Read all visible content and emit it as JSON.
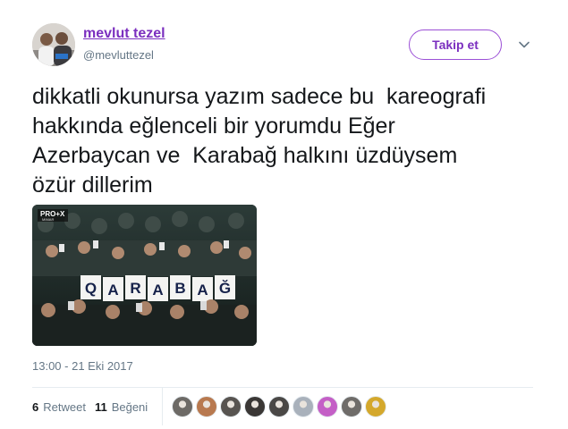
{
  "author": {
    "name": "mevlut tezel",
    "handle": "@mevluttezel"
  },
  "follow_button": {
    "label": "Takip et"
  },
  "menu_icon": "chevron-down-icon",
  "tweet": {
    "text": "dikkatli okunursa yazım sadece bu  kareografi\nhakkında eğlenceli bir yorumdu Eğer\nAzerbaycan ve  Karabağ halkını üzdüysem\nözür dillerim",
    "timestamp": "13:00 - 21 Eki 2017"
  },
  "media": {
    "banner_letters": [
      "Q",
      "A",
      "R",
      "A",
      "B",
      "A",
      "Ğ"
    ],
    "tv_logo": "PRO+X",
    "tv_logo_sub": "MIMAR"
  },
  "stats": {
    "retweet_count": "6",
    "retweet_label": "Retweet",
    "like_count": "11",
    "like_label": "Beğeni"
  },
  "likers": [
    {
      "name": "liker-avatar-1",
      "color": "#6d6a66"
    },
    {
      "name": "liker-avatar-2",
      "color": "#b8794f"
    },
    {
      "name": "liker-avatar-3",
      "color": "#585450"
    },
    {
      "name": "liker-avatar-4",
      "color": "#3a3735"
    },
    {
      "name": "liker-avatar-5",
      "color": "#4a4846"
    },
    {
      "name": "liker-avatar-6",
      "color": "#a9b1bb"
    },
    {
      "name": "liker-avatar-7",
      "color": "#c45fc6"
    },
    {
      "name": "liker-avatar-8",
      "color": "#6f6c69"
    },
    {
      "name": "liker-avatar-9",
      "color": "#d4a82c"
    }
  ],
  "colors": {
    "accent": "#7b2fbf",
    "text": "#14171a",
    "muted": "#657786",
    "divider": "#e6ecf0"
  }
}
